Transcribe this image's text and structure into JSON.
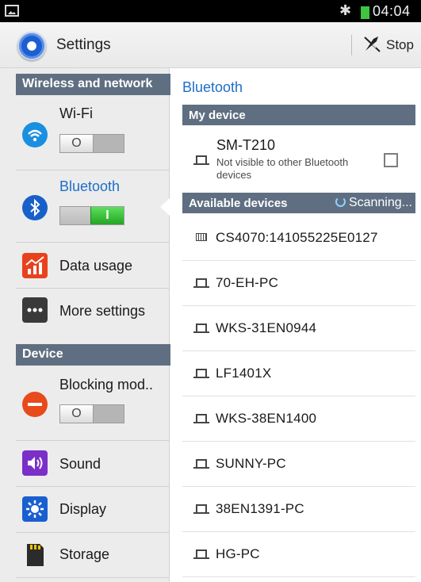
{
  "status_bar": {
    "bluetooth_symbol": "✱",
    "time": "04:04"
  },
  "action_bar": {
    "title": "Settings",
    "stop_label": "Stop"
  },
  "left_pane": {
    "section_wireless": "Wireless and network",
    "section_device": "Device",
    "items": {
      "wifi": {
        "label": "Wi-Fi",
        "toggle": "O",
        "toggle_state": "off"
      },
      "bluetooth": {
        "label": "Bluetooth",
        "toggle": "I",
        "toggle_state": "on"
      },
      "data_usage": {
        "label": "Data usage"
      },
      "more_settings": {
        "label": "More settings"
      },
      "blocking_mode": {
        "label": "Blocking mod..",
        "toggle": "O",
        "toggle_state": "off"
      },
      "sound": {
        "label": "Sound"
      },
      "display": {
        "label": "Display"
      },
      "storage": {
        "label": "Storage"
      }
    }
  },
  "right_pane": {
    "title": "Bluetooth",
    "my_device_header": "My device",
    "my_device": {
      "name": "SM-T210",
      "subtitle": "Not visible to other Bluetooth devices",
      "visible_checked": false
    },
    "available_header": "Available devices",
    "scanning_label": "Scanning...",
    "devices": [
      {
        "name": "CS4070:141055225E0127",
        "icon": "keyboard-icon"
      },
      {
        "name": "70-EH-PC",
        "icon": "laptop-icon"
      },
      {
        "name": "WKS-31EN0944",
        "icon": "laptop-icon"
      },
      {
        "name": "LF1401X",
        "icon": "laptop-icon"
      },
      {
        "name": "WKS-38EN1400",
        "icon": "laptop-icon"
      },
      {
        "name": "SUNNY-PC",
        "icon": "laptop-icon"
      },
      {
        "name": "38EN1391-PC",
        "icon": "laptop-icon"
      },
      {
        "name": "HG-PC",
        "icon": "laptop-icon"
      }
    ]
  },
  "colors": {
    "accent_blue": "#1e6ec9",
    "header_slate": "#5f6f81",
    "toggle_on_green": "#25a425",
    "wifi_icon": "#1a8fe0",
    "blocking_icon": "#e84a1c"
  }
}
